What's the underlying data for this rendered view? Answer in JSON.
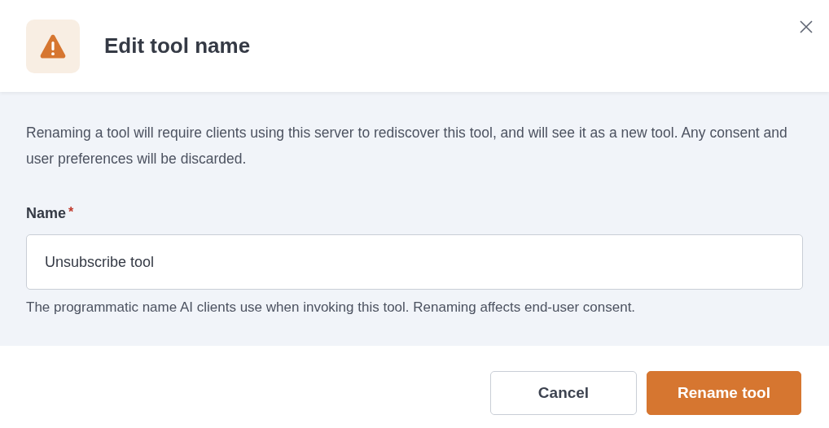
{
  "dialog": {
    "title": "Edit tool name",
    "description": "Renaming a tool will require clients using this server to rediscover this tool, and will see it as a new tool. Any consent and user preferences will be discarded.",
    "field": {
      "label": "Name",
      "required_mark": "*",
      "value": "Unsubscribe tool",
      "hint": "The programmatic name AI clients use when invoking this tool. Renaming affects end-user consent."
    },
    "buttons": [
      {
        "label": "Cancel",
        "kind": "secondary"
      },
      {
        "label": "Rename tool",
        "kind": "primary"
      }
    ]
  }
}
